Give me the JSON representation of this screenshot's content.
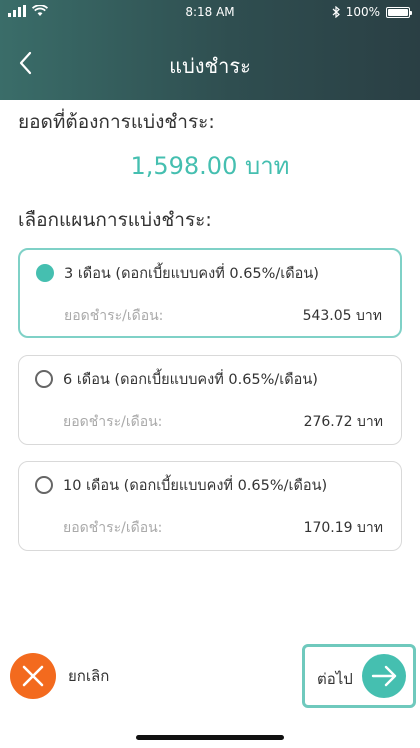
{
  "status_bar": {
    "time": "8:18 AM",
    "battery_text": "100%",
    "battery_level": 1.0,
    "icons": [
      "signal-icon",
      "wifi-icon",
      "bluetooth-icon",
      "battery-icon"
    ]
  },
  "header": {
    "title": "แบ่งชำระ",
    "back_icon": "chevron-left-icon"
  },
  "amount_section": {
    "label": "ยอดที่ต้องการแบ่งชำระ:",
    "amount": "1,598.00 บาท"
  },
  "plan_section": {
    "label": "เลือกแผนการแบ่งชำระ:",
    "plans": [
      {
        "title": "3 เดือน (ดอกเบี้ยแบบคงที่ 0.65%/เดือน)",
        "sub_label": "ยอดชำระ/เดือน:",
        "sub_value": "543.05 บาท",
        "selected": true
      },
      {
        "title": "6 เดือน (ดอกเบี้ยแบบคงที่ 0.65%/เดือน)",
        "sub_label": "ยอดชำระ/เดือน:",
        "sub_value": "276.72 บาท",
        "selected": false
      },
      {
        "title": "10 เดือน (ดอกเบี้ยแบบคงที่ 0.65%/เดือน)",
        "sub_label": "ยอดชำระ/เดือน:",
        "sub_value": "170.19 บาท",
        "selected": false
      }
    ]
  },
  "footer": {
    "cancel_label": "ยกเลิก",
    "next_label": "ต่อไป"
  },
  "colors": {
    "accent": "#45bfb0",
    "cancel": "#f36a1e",
    "header_start": "#3a6d69",
    "header_end": "#2a3f44"
  }
}
